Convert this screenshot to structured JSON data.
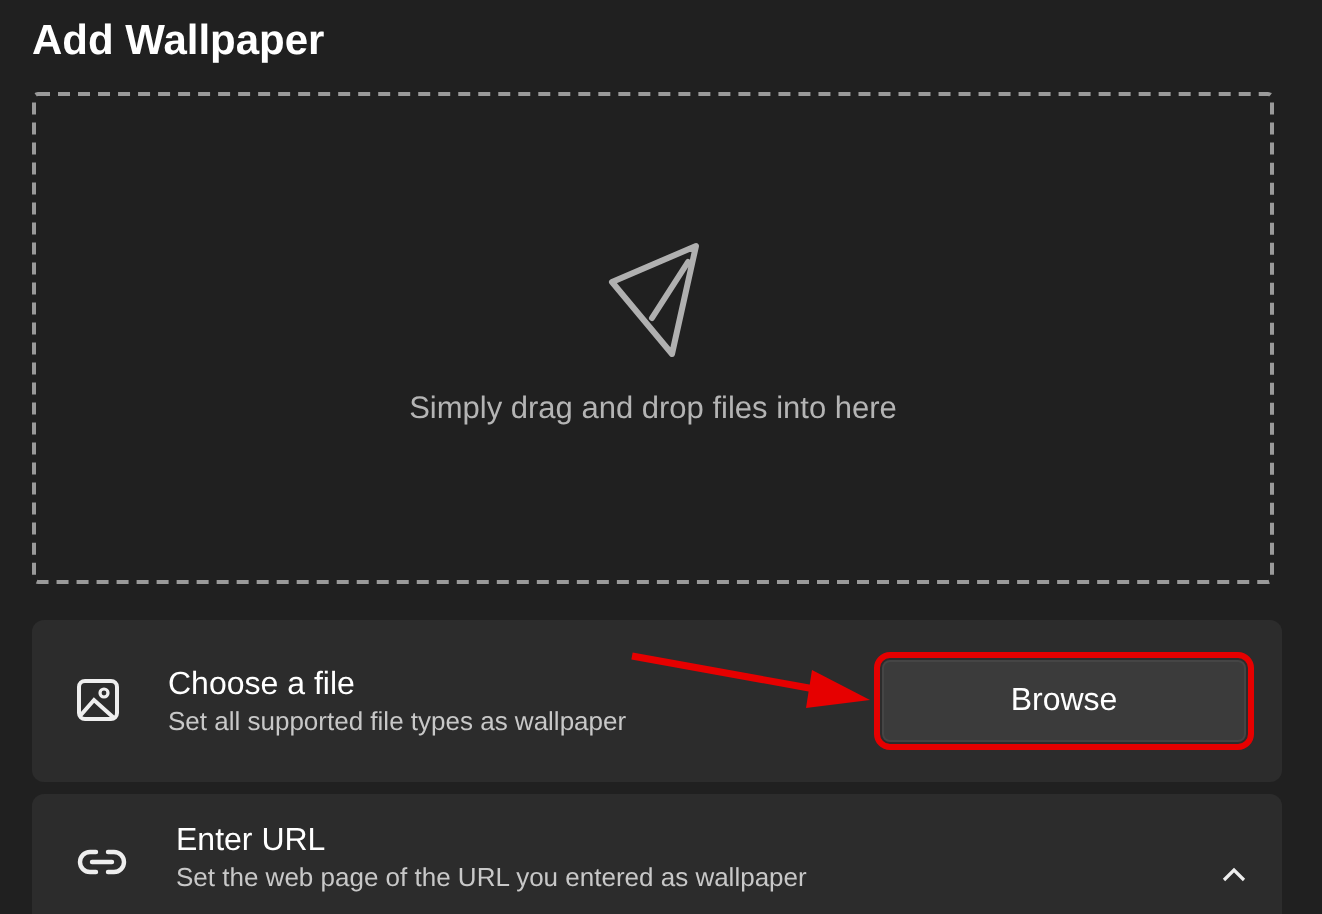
{
  "title": "Add Wallpaper",
  "dropzone": {
    "text": "Simply drag and drop files into here"
  },
  "options": [
    {
      "kind": "file",
      "title": "Choose a file",
      "subtitle": "Set all supported file types as wallpaper",
      "button": {
        "label": "Browse",
        "highlighted": true
      },
      "pointer_arrow": true
    },
    {
      "kind": "url",
      "title": "Enter URL",
      "subtitle": "Set the web page of the URL you entered as wallpaper",
      "expanded": true
    }
  ]
}
